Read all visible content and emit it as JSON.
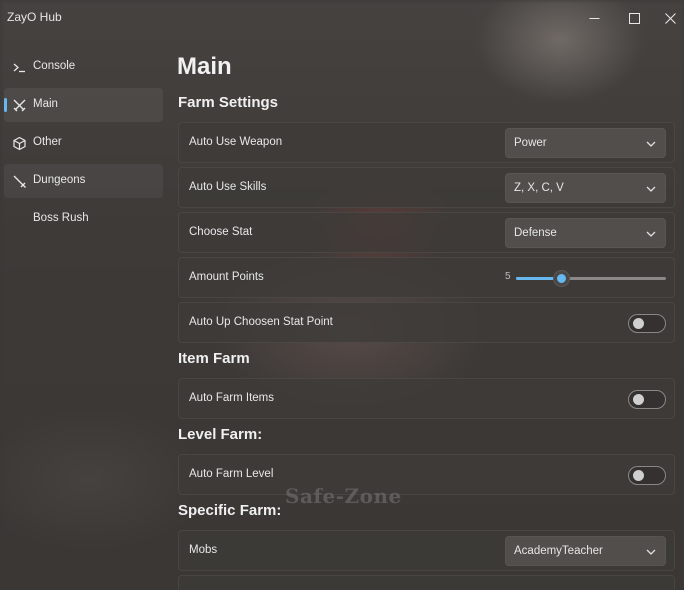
{
  "window": {
    "title": "ZayO Hub",
    "controls": {
      "minimize": "minimize-icon",
      "maximize": "maximize-icon",
      "close": "close-icon"
    }
  },
  "sidebar": {
    "items": [
      {
        "label": "Console",
        "icon": "terminal-icon"
      },
      {
        "label": "Main",
        "icon": "crossed-swords-icon",
        "active": true
      },
      {
        "label": "Other",
        "icon": "cube-icon"
      },
      {
        "label": "Dungeons",
        "icon": "sword-icon"
      },
      {
        "label": "Boss Rush",
        "icon": ""
      }
    ]
  },
  "main": {
    "title": "Main",
    "sections": {
      "farm_settings": {
        "title": "Farm Settings",
        "auto_use_weapon": {
          "label": "Auto Use Weapon",
          "value": "Power"
        },
        "auto_use_skills": {
          "label": "Auto Use Skills",
          "value": "Z, X, C, V"
        },
        "choose_stat": {
          "label": "Choose Stat",
          "value": "Defense"
        },
        "amount_points": {
          "label": "Amount Points",
          "value": "5",
          "min": 0,
          "max": 100
        },
        "auto_up_stat": {
          "label": "Auto Up Choosen Stat Point",
          "enabled": false
        }
      },
      "item_farm": {
        "title": "Item Farm",
        "auto_farm_items": {
          "label": "Auto Farm Items",
          "enabled": false
        }
      },
      "level_farm": {
        "title": "Level Farm:",
        "auto_farm_level": {
          "label": "Auto Farm Level",
          "enabled": false
        }
      },
      "specific_farm": {
        "title": "Specific Farm:",
        "mobs": {
          "label": "Mobs",
          "value": "AcademyTeacher"
        }
      }
    }
  },
  "overlay": {
    "watermark": "Safe-Zone"
  },
  "colors": {
    "accent": "#67b7f0",
    "row_bg": "#3e3b39",
    "text": "#e8e8e8"
  }
}
